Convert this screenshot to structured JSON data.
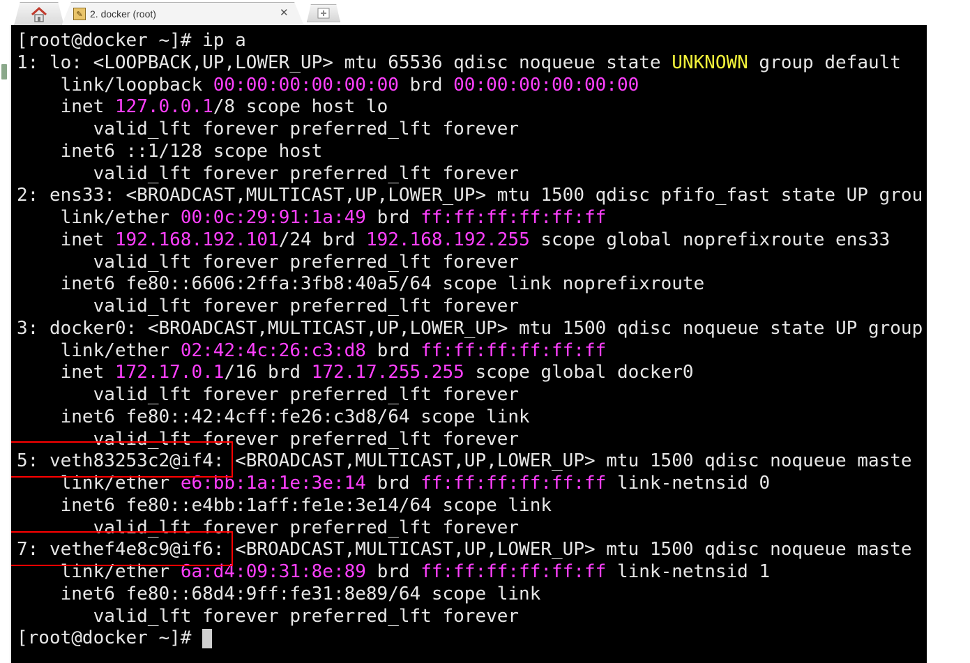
{
  "tab": {
    "title": "2. docker (root)",
    "close_glyph": "✕",
    "icon": "wrench-icon"
  },
  "colors": {
    "terminal_bg": "#000000",
    "text": "#e6e6e6",
    "address": "#ff40ff",
    "state_unknown": "#f2f23a",
    "highlight": "#ff0000"
  },
  "terminal": {
    "lines": [
      [
        {
          "t": "[root@docker ~]# ip a"
        }
      ],
      [
        {
          "t": "1: lo: <LOOPBACK,UP,LOWER_UP> mtu 65536 qdisc noqueue state "
        },
        {
          "t": "UNKNOWN",
          "c": "yel"
        },
        {
          "t": " group default "
        }
      ],
      [
        {
          "t": "    link/loopback "
        },
        {
          "t": "00:00:00:00:00:00",
          "c": "mag"
        },
        {
          "t": " brd "
        },
        {
          "t": "00:00:00:00:00:00",
          "c": "mag"
        }
      ],
      [
        {
          "t": "    inet "
        },
        {
          "t": "127.0.0.1",
          "c": "mag"
        },
        {
          "t": "/8 scope host lo"
        }
      ],
      [
        {
          "t": "       valid_lft forever preferred_lft forever"
        }
      ],
      [
        {
          "t": "    inet6 ::1/128 scope host"
        }
      ],
      [
        {
          "t": "       valid_lft forever preferred_lft forever"
        }
      ],
      [
        {
          "t": "2: ens33: <BROADCAST,MULTICAST,UP,LOWER_UP> mtu 1500 qdisc pfifo_fast state UP grou"
        }
      ],
      [
        {
          "t": "    link/ether "
        },
        {
          "t": "00:0c:29:91:1a:49",
          "c": "mag"
        },
        {
          "t": " brd "
        },
        {
          "t": "ff:ff:ff:ff:ff:ff",
          "c": "mag"
        }
      ],
      [
        {
          "t": "    inet "
        },
        {
          "t": "192.168.192.101",
          "c": "mag"
        },
        {
          "t": "/24 brd "
        },
        {
          "t": "192.168.192.255",
          "c": "mag"
        },
        {
          "t": " scope global noprefixroute ens33"
        }
      ],
      [
        {
          "t": "       valid_lft forever preferred_lft forever"
        }
      ],
      [
        {
          "t": "    inet6 fe80::6606:2ffa:3fb8:40a5/64 scope link noprefixroute"
        }
      ],
      [
        {
          "t": "       valid_lft forever preferred_lft forever"
        }
      ],
      [
        {
          "t": "3: docker0: <BROADCAST,MULTICAST,UP,LOWER_UP> mtu 1500 qdisc noqueue state UP group"
        }
      ],
      [
        {
          "t": "    link/ether "
        },
        {
          "t": "02:42:4c:26:c3:d8",
          "c": "mag"
        },
        {
          "t": " brd "
        },
        {
          "t": "ff:ff:ff:ff:ff:ff",
          "c": "mag"
        }
      ],
      [
        {
          "t": "    inet "
        },
        {
          "t": "172.17.0.1",
          "c": "mag"
        },
        {
          "t": "/16 brd "
        },
        {
          "t": "172.17.255.255",
          "c": "mag"
        },
        {
          "t": " scope global docker0"
        }
      ],
      [
        {
          "t": "       valid_lft forever preferred_lft forever"
        }
      ],
      [
        {
          "t": "    inet6 fe80::42:4cff:fe26:c3d8/64 scope link"
        }
      ],
      [
        {
          "t": "       valid_lft forever preferred_lft forever"
        }
      ],
      [
        {
          "t": "5: veth83253c2@if4: <BROADCAST,MULTICAST,UP,LOWER_UP> mtu 1500 qdisc noqueue maste"
        }
      ],
      [
        {
          "t": "    link/ether "
        },
        {
          "t": "e6:bb:1a:1e:3e:14",
          "c": "mag"
        },
        {
          "t": " brd "
        },
        {
          "t": "ff:ff:ff:ff:ff:ff",
          "c": "mag"
        },
        {
          "t": " link-netnsid 0"
        }
      ],
      [
        {
          "t": "    inet6 fe80::e4bb:1aff:fe1e:3e14/64 scope link"
        }
      ],
      [
        {
          "t": "       valid_lft forever preferred_lft forever"
        }
      ],
      [
        {
          "t": "7: vethef4e8c9@if6: <BROADCAST,MULTICAST,UP,LOWER_UP> mtu 1500 qdisc noqueue maste"
        }
      ],
      [
        {
          "t": "    link/ether "
        },
        {
          "t": "6a:d4:09:31:8e:89",
          "c": "mag"
        },
        {
          "t": " brd "
        },
        {
          "t": "ff:ff:ff:ff:ff:ff",
          "c": "mag"
        },
        {
          "t": " link-netnsid 1"
        }
      ],
      [
        {
          "t": "    inet6 fe80::68d4:9ff:fe31:8e89/64 scope link"
        }
      ],
      [
        {
          "t": "       valid_lft forever preferred_lft forever"
        }
      ],
      [
        {
          "t": "[root@docker ~]# "
        }
      ]
    ]
  }
}
